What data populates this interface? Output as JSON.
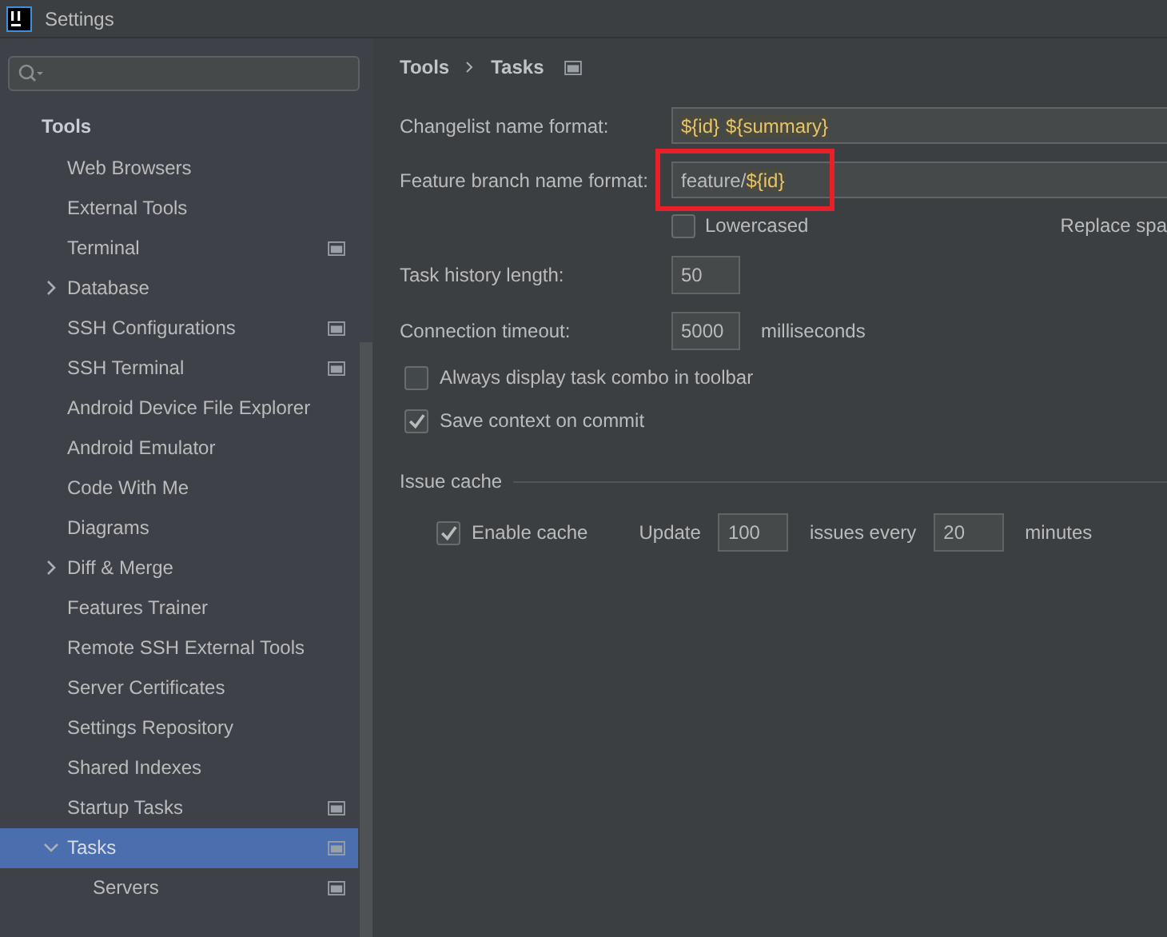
{
  "window": {
    "title": "Settings"
  },
  "sidebar": {
    "section": "Tools",
    "items": [
      {
        "label": "Web Browsers",
        "expandable": false,
        "project_icon": false,
        "selected": false
      },
      {
        "label": "External Tools",
        "expandable": false,
        "project_icon": false,
        "selected": false
      },
      {
        "label": "Terminal",
        "expandable": false,
        "project_icon": true,
        "selected": false
      },
      {
        "label": "Database",
        "expandable": true,
        "expanded": false,
        "project_icon": false,
        "selected": false
      },
      {
        "label": "SSH Configurations",
        "expandable": false,
        "project_icon": true,
        "selected": false
      },
      {
        "label": "SSH Terminal",
        "expandable": false,
        "project_icon": true,
        "selected": false
      },
      {
        "label": "Android Device File Explorer",
        "expandable": false,
        "project_icon": false,
        "selected": false
      },
      {
        "label": "Android Emulator",
        "expandable": false,
        "project_icon": false,
        "selected": false
      },
      {
        "label": "Code With Me",
        "expandable": false,
        "project_icon": false,
        "selected": false
      },
      {
        "label": "Diagrams",
        "expandable": false,
        "project_icon": false,
        "selected": false
      },
      {
        "label": "Diff & Merge",
        "expandable": true,
        "expanded": false,
        "project_icon": false,
        "selected": false
      },
      {
        "label": "Features Trainer",
        "expandable": false,
        "project_icon": false,
        "selected": false
      },
      {
        "label": "Remote SSH External Tools",
        "expandable": false,
        "project_icon": false,
        "selected": false
      },
      {
        "label": "Server Certificates",
        "expandable": false,
        "project_icon": false,
        "selected": false
      },
      {
        "label": "Settings Repository",
        "expandable": false,
        "project_icon": false,
        "selected": false
      },
      {
        "label": "Shared Indexes",
        "expandable": false,
        "project_icon": false,
        "selected": false
      },
      {
        "label": "Startup Tasks",
        "expandable": false,
        "project_icon": true,
        "selected": false
      },
      {
        "label": "Tasks",
        "expandable": true,
        "expanded": true,
        "project_icon": true,
        "selected": true,
        "children": [
          {
            "label": "Servers",
            "expandable": false,
            "project_icon": true,
            "selected": false
          }
        ]
      }
    ]
  },
  "breadcrumb": [
    "Tools",
    "Tasks"
  ],
  "form": {
    "changelist": {
      "label": "Changelist name format:",
      "value_parts": [
        {
          "text": "${id}",
          "kind": "variable"
        },
        {
          "text": "${summary}",
          "kind": "variable"
        }
      ]
    },
    "feature_branch": {
      "label": "Feature branch name format:",
      "value_parts": [
        {
          "text": "feature/",
          "kind": "text"
        },
        {
          "text": "${id}",
          "kind": "variable"
        }
      ],
      "highlighted": true
    },
    "lowercased": {
      "label": "Lowercased",
      "checked": false
    },
    "replace_spaces": {
      "label": "Replace spa"
    },
    "history": {
      "label": "Task history length:",
      "value": "50"
    },
    "timeout": {
      "label": "Connection timeout:",
      "value": "5000",
      "unit": "milliseconds"
    },
    "checkboxes": [
      {
        "label": "Always display task combo in toolbar",
        "checked": false
      },
      {
        "label": "Save context on commit",
        "checked": true
      }
    ],
    "issue_cache": {
      "title": "Issue cache",
      "enable": {
        "label": "Enable cache",
        "checked": true
      },
      "update_label": "Update",
      "count": "100",
      "every_label": "issues every",
      "minutes": "20",
      "minutes_label": "minutes"
    }
  }
}
